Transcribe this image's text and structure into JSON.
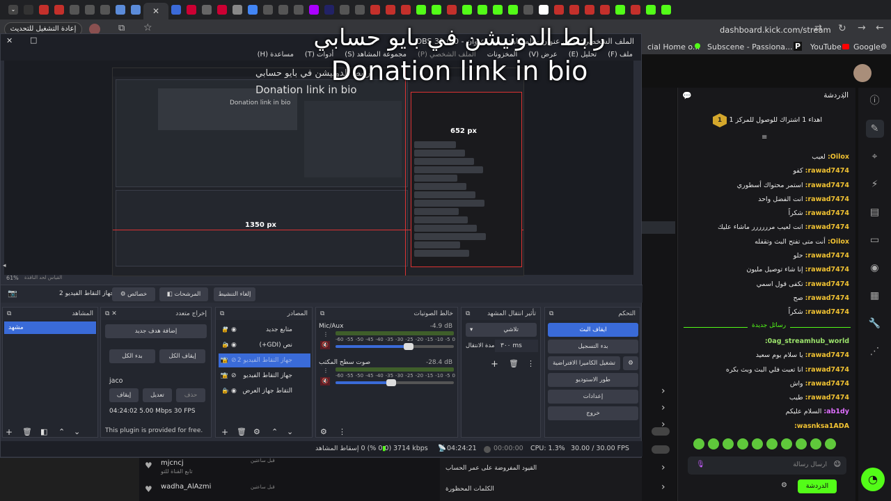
{
  "browser": {
    "update_button": "إعادة التشغيل للتحديث",
    "url": "dashboard.kick.com/stream",
    "bookmarks": [
      "cial Home o...",
      "Subscene - Passiona...",
      "YouTube",
      "Google"
    ]
  },
  "overlay": {
    "arabic": "رابط الدونيشن في بايو حسابي",
    "english": "Donation link in bio"
  },
  "obs": {
    "title": "الملف الشخصي: بدون عنوان - المشاهد: بدون عنوان - OBS 31.0.0",
    "menu": [
      "ملف (F)",
      "تحليل (E)",
      "عرض (V)",
      "المخزونات",
      "الملف الشخصي (P)",
      "مجموعة المشاهد (S)",
      "أدوات (T)",
      "مساعدة (H)"
    ],
    "zoom": "61%",
    "zoom_hint": "القياس لحد النافذة",
    "scene_toolbar": {
      "source_name": "جهاز التقاط الفيديو 2",
      "props": "خصائص",
      "filters": "المرشحات",
      "deactivate": "إلغاء التنشيط"
    },
    "inner_preview": {
      "line1": "رابط الدونيشن في بايو حسابي",
      "line2": "Donation link in bio",
      "line3": "Donation link in bio",
      "px_h": "1350 px",
      "px_v": "652 px"
    },
    "docks": {
      "scenes": {
        "title": "المشاهد",
        "items": [
          "مشهد"
        ]
      },
      "multi_output": {
        "title": "إخراج متعدد",
        "add_target": "إضافة هدف جديد",
        "start_all": "بدء الكل",
        "stop_all": "إيقاف الكل",
        "target_name": "jaco",
        "stop": "إيقاف",
        "edit": "تعديل",
        "delete": "حذف",
        "stats": "04:24:02  5.00 Mbps  30 FPS",
        "plugin_note": "This plugin is provided for free."
      },
      "sources": {
        "title": "المصادر",
        "items": [
          "متابع جديد",
          "نص (GDI+)",
          "جهاز التقاط الفيديو 2",
          "جهاز التقاط الفيديو",
          "التقاط جهاز العرض"
        ]
      },
      "mixer": {
        "title": "خالط الصوتيات",
        "channels": [
          {
            "name": "Mic/Aux",
            "db": "-4.9 dB",
            "level": 0.62
          },
          {
            "name": "صوت سطح المكتب",
            "db": "-28.4 dB",
            "level": 0.47
          }
        ],
        "ticks": [
          "-60",
          "-55",
          "-50",
          "-45",
          "-40",
          "-35",
          "-30",
          "-25",
          "-20",
          "-15",
          "-10",
          "-5",
          "0"
        ]
      },
      "transitions": {
        "title": "تأثير انتقال المشهد",
        "type": "تلاشي",
        "duration_label": "مدة الانتقال",
        "duration": "٣٠٠ ms"
      },
      "controls": {
        "title": "التحكم",
        "buttons": [
          "ايقاف البث",
          "بدء التسجيل",
          "تشغيل الكاميرا الافتراضية",
          "طور الاستوديو",
          "إعدادات",
          "خروج"
        ]
      }
    },
    "status": {
      "dropped": "(0.0 %) 0 إسقاط المشاهد",
      "bitrate": "3714 kbps",
      "live_time": "04:24:21",
      "rec_time": "00:00:00",
      "cpu": "CPU: 1.3%",
      "fps": "30.00 / 30.00 FPS"
    }
  },
  "kick": {
    "chat_title": "الدردشة",
    "pinned": "اهداء 1 اشتراك للوصول للمركز 1",
    "pinned_rank": "1",
    "new_messages": "رسائل جديدة",
    "messages_before": [
      {
        "user": "Oilox",
        "text": "لعيب"
      },
      {
        "user": "rawad7474",
        "text": "كفو"
      },
      {
        "user": "rawad7474",
        "text": "استمر محتواك أسطوري"
      },
      {
        "user": "rawad7474",
        "text": "انت الفضل واحد"
      },
      {
        "user": "rawad7474",
        "text": "شكراً"
      },
      {
        "user": "rawad7474",
        "text": "انت لعيب مرررررر ماشاء عليك"
      },
      {
        "user": "Oilox",
        "text": "أنت متى تفتح البث وتقفله"
      },
      {
        "user": "rawad7474",
        "text": "حلو"
      },
      {
        "user": "rawad7474",
        "text": "إنا شاء توصيل مليون"
      },
      {
        "user": "rawad7474",
        "text": "تكفى قول اسمي"
      },
      {
        "user": "rawad7474",
        "text": "صح"
      },
      {
        "user": "rawad7474",
        "text": "شكراً"
      }
    ],
    "messages_after": [
      {
        "user": "0ag_streamhub_world",
        "text": "",
        "color": "g"
      },
      {
        "user": "rawad7474",
        "text": "يا سلام يوم سعيد"
      },
      {
        "user": "rawad7474",
        "text": "انا تعبت فلي البث وبث بكره"
      },
      {
        "user": "rawad7474",
        "text": "واش"
      },
      {
        "user": "rawad7474",
        "text": "طيب"
      },
      {
        "user": "ab1dy",
        "text": "السلام عليكم",
        "color": "p"
      },
      {
        "user": "wasnksa1ADA",
        "text": ""
      }
    ],
    "input_placeholder": "ارسال رسالة",
    "chat_button": "الدردشة",
    "bottom_rows": [
      {
        "user": "mjcncj",
        "sub": "تابع القناة للتو",
        "time": "قبل ساعتين"
      },
      {
        "user": "wadha_AlAzmi",
        "sub": "",
        "time": "قبل ساعتين"
      }
    ],
    "bottom_panels": [
      "القيود المفروضة على عمر الحساب",
      "الكلمات المحظورة"
    ]
  },
  "colors": {
    "obs_accent": "#3a6bd8",
    "kick_green": "#53fc18",
    "username": "#f1c232",
    "live_red": "#c0392b"
  }
}
